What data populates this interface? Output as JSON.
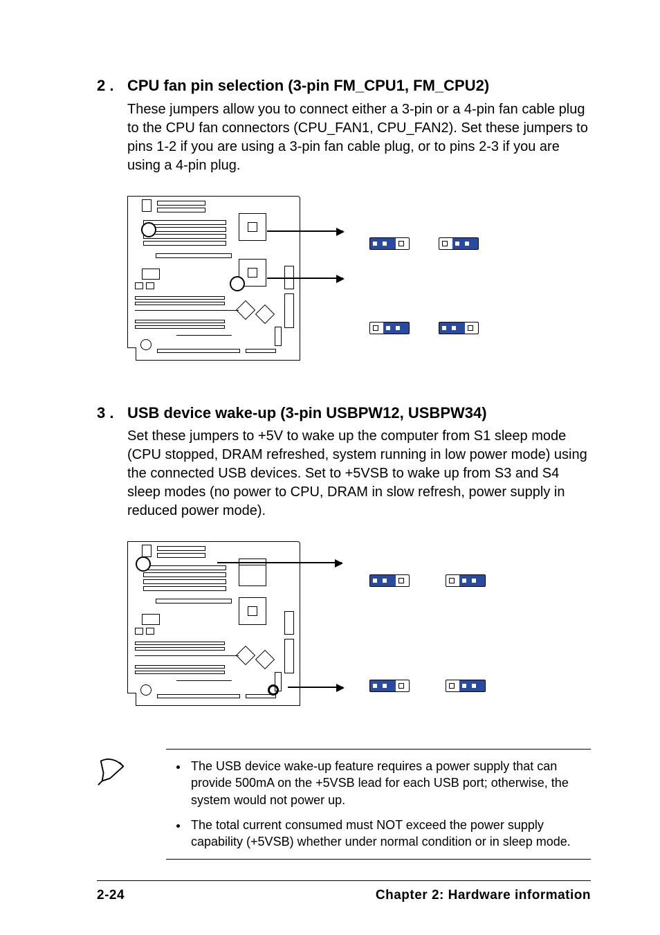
{
  "section2": {
    "num": "2 .",
    "title": "CPU fan pin selection (3-pin FM_CPU1, FM_CPU2)",
    "body": "These jumpers allow you to connect either a 3-pin or a 4-pin fan cable plug to the CPU fan connectors (CPU_FAN1, CPU_FAN2). Set these jumpers to pins 1-2 if you are using a 3-pin fan cable plug, or to pins 2-3 if you are using a 4-pin plug."
  },
  "section3": {
    "num": "3 .",
    "title": "USB device wake-up (3-pin USBPW12, USBPW34)",
    "body": "Set these jumpers to +5V to wake up the computer from S1 sleep mode (CPU stopped, DRAM refreshed, system running in low power mode) using the connected USB devices. Set to +5VSB to wake up from S3 and S4 sleep modes (no power to CPU, DRAM in slow refresh, power supply in reduced power mode)."
  },
  "notes": {
    "item1": "The USB device wake-up feature requires a power supply that can provide 500mA on the +5VSB lead for each USB port; otherwise, the system would not power up.",
    "item2": "The total current consumed must NOT exceed the power supply capability (+5VSB) whether under normal condition or in sleep mode."
  },
  "footer": {
    "page": "2-24",
    "chapter": "Chapter 2: Hardware information"
  }
}
